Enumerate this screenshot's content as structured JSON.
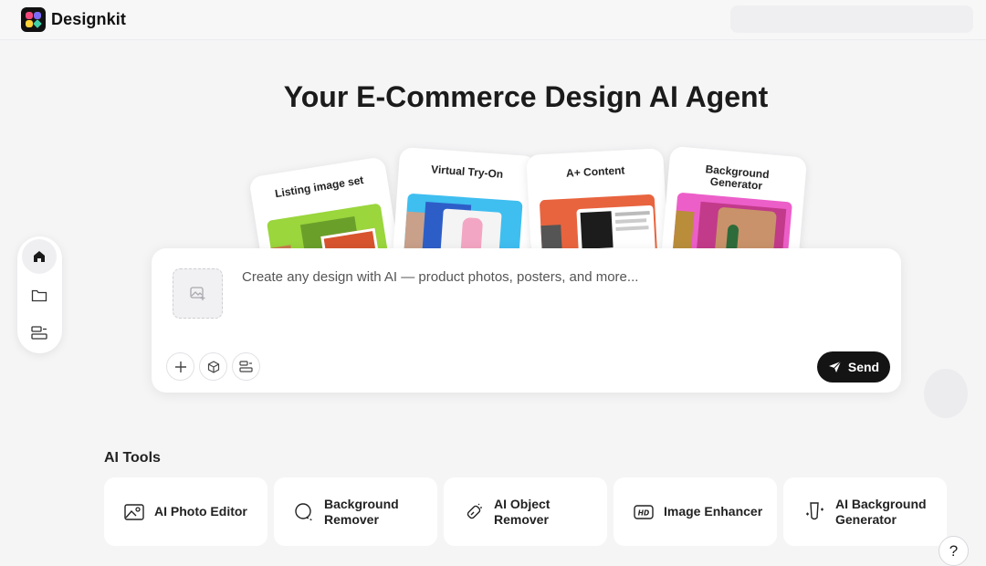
{
  "header": {
    "brand": "Designkit"
  },
  "hero": {
    "title": "Your E-Commerce Design AI Agent"
  },
  "cards": [
    {
      "title": "Listing image set"
    },
    {
      "title": "Virtual Try-On"
    },
    {
      "title": "A+ Content"
    },
    {
      "title": "Background Generator"
    }
  ],
  "prompt": {
    "placeholder": "Create any design with AI — product photos, posters, and more...",
    "send_label": "Send"
  },
  "tools": {
    "title": "AI Tools",
    "items": [
      {
        "label": "AI Photo Editor",
        "icon": "photo-editor-icon"
      },
      {
        "label": "Background Remover",
        "icon": "background-remover-icon"
      },
      {
        "label": "AI Object Remover",
        "icon": "eraser-icon"
      },
      {
        "label": "Image Enhancer",
        "icon": "hd-icon"
      },
      {
        "label": "AI Background Generator",
        "icon": "background-generator-icon"
      }
    ]
  },
  "help": {
    "label": "?"
  },
  "colors": {
    "accent": "#141414",
    "background": "#f5f5f6"
  }
}
